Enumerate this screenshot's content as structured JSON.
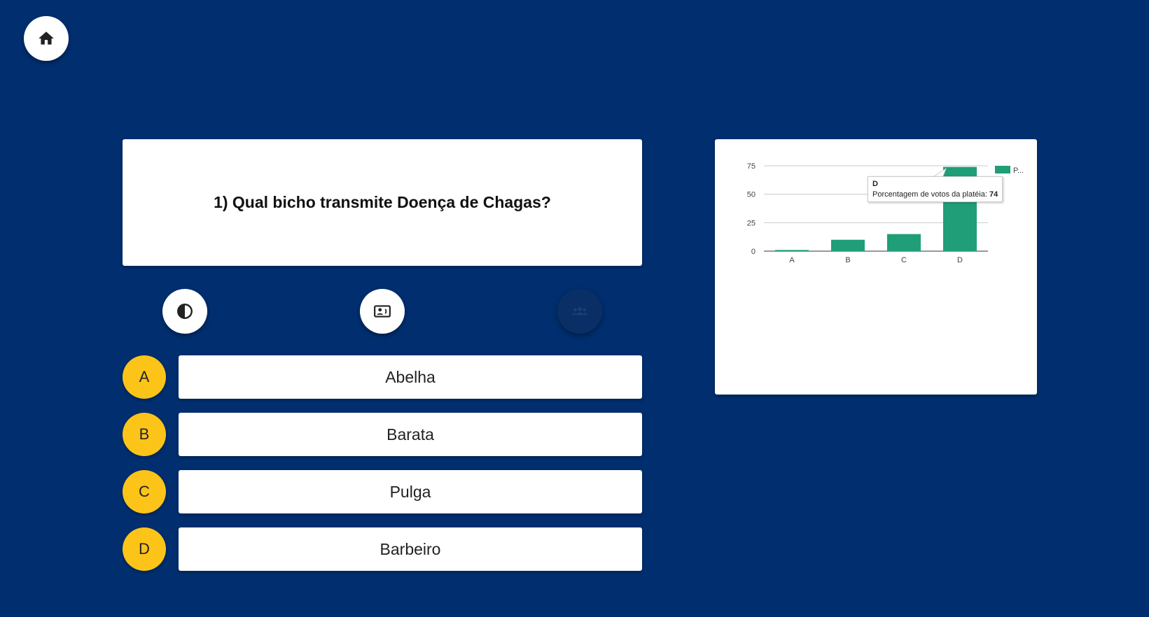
{
  "question": {
    "text": "1) Qual bicho transmite Doença de Chagas?"
  },
  "home": {
    "icon": "home-icon"
  },
  "lifelines": [
    {
      "name": "half",
      "icon": "contrast-icon",
      "enabled": true
    },
    {
      "name": "cards",
      "icon": "contact-card-icon",
      "enabled": true
    },
    {
      "name": "audience",
      "icon": "group-icon",
      "enabled": false
    }
  ],
  "options": [
    {
      "letter": "A",
      "label": "Abelha"
    },
    {
      "letter": "B",
      "label": "Barata"
    },
    {
      "letter": "C",
      "label": "Pulga"
    },
    {
      "letter": "D",
      "label": "Barbeiro"
    }
  ],
  "colors": {
    "background": "#002e6e",
    "letter": "#fcc419",
    "bar": "#1f9e78"
  },
  "chart_data": {
    "type": "bar",
    "categories": [
      "A",
      "B",
      "C",
      "D"
    ],
    "series": [
      {
        "name": "Porcentagem de votos da platéia",
        "values": [
          1,
          10,
          15,
          74
        ]
      }
    ],
    "legend_text": "P...",
    "legend_position": "right",
    "ylim": [
      0,
      75
    ],
    "yticks": [
      0,
      25,
      50,
      75
    ],
    "grid": true,
    "tooltip": {
      "title": "D",
      "label": "Porcentagem de votos da platéia:",
      "value": "74"
    }
  }
}
